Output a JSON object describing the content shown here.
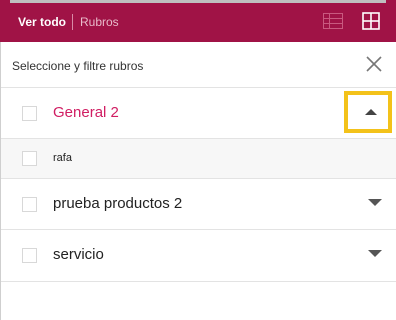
{
  "header": {
    "ver_todo": "Ver todo",
    "rubros": "Rubros",
    "list_view_icon": "list-view-icon",
    "grid_view_icon": "grid-view-icon",
    "background": "#a01346"
  },
  "panel": {
    "title": "Seleccione y filtre rubros",
    "close_icon": "close-icon"
  },
  "rubros": [
    {
      "label": "General 2",
      "expanded": true,
      "highlighted": true,
      "accent": "#d01d62"
    },
    {
      "label": "rafa",
      "subitem": true
    },
    {
      "label": "prueba productos 2",
      "expanded": false
    },
    {
      "label": "servicio",
      "expanded": false
    }
  ],
  "highlight_color": "#f3c21a"
}
